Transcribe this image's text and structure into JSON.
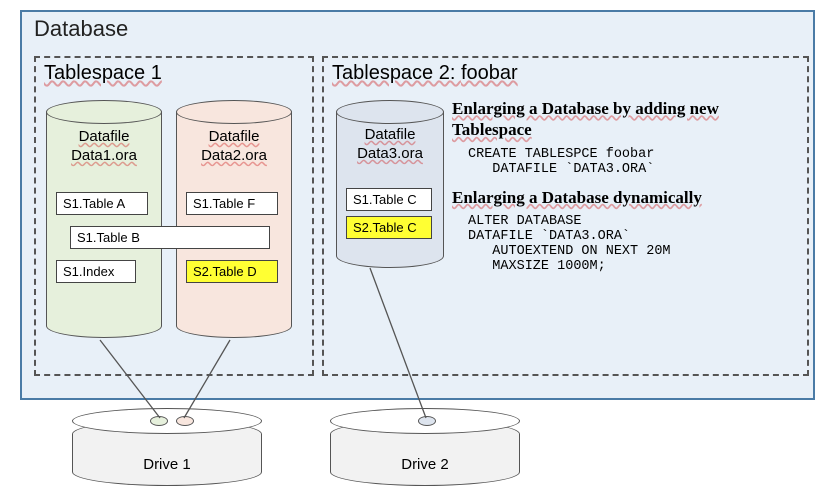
{
  "database": {
    "title": "Database"
  },
  "tablespace1": {
    "title": "Tablespace 1",
    "datafile1": {
      "label": "Datafile\nData1.ora",
      "tables": [
        "S1.Table A",
        "S1.Table B",
        "S1.Index"
      ]
    },
    "datafile2": {
      "label": "Datafile\nData2.ora",
      "tables": [
        "S1.Table F",
        "S2.Table D"
      ]
    }
  },
  "tablespace2": {
    "title_prefix": "Tablespace 2: ",
    "title_name": "foobar",
    "datafile3": {
      "label": "Datafile\nData3.ora",
      "tables": [
        "S1.Table C",
        "S2.Table C"
      ]
    },
    "heading1": "Enlarging a Database by adding new Tablespace",
    "code1": "CREATE TABLESPCE foobar\n   DATAFILE `DATA3.ORA`",
    "heading2": "Enlarging a Database dynamically",
    "code2": "ALTER DATABASE\nDATAFILE `DATA3.ORA`\n   AUTOEXTEND ON NEXT 20M\n   MAXSIZE 1000M;"
  },
  "drives": {
    "d1": "Drive 1",
    "d2": "Drive 2"
  },
  "colors": {
    "df1": "#e6f0dc",
    "df2": "#f8e6de",
    "df3": "#dde4ee"
  }
}
